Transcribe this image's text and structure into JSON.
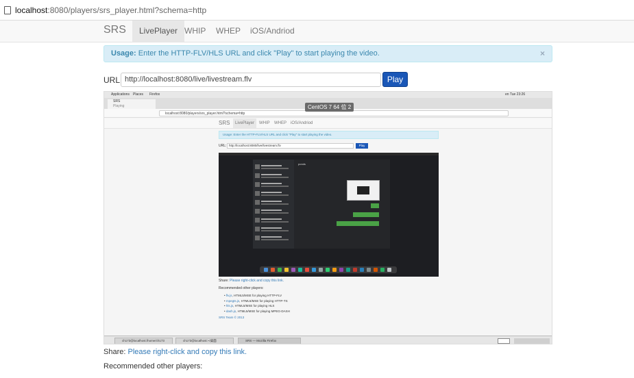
{
  "browser": {
    "url_host": "localhost",
    "url_rest": ":8080/players/srs_player.html?schema=http"
  },
  "navbar": {
    "brand": "SRS",
    "tabs": [
      "LivePlayer",
      "WHIP",
      "WHEP",
      "iOS/Andriod"
    ],
    "active_tab": "LivePlayer"
  },
  "alert": {
    "label": "Usage:",
    "text": "Enter the HTTP-FLV/HLS URL and click \"Play\" to start playing the video.",
    "close": "×"
  },
  "player": {
    "url_label": "URL:",
    "url_value": "http://localhost:8080/live/livestream.flv",
    "play_label": "Play"
  },
  "video": {
    "gnome_menu": [
      "Applications",
      "Places",
      "Firefox"
    ],
    "gnome_status": "en  Tue 23:26",
    "ff_tab": "SRS",
    "ff_tab_sub": "Playing",
    "ff_url": "localhost:8080/players/srs_player.html?schema=http",
    "vm_badge": "CentOS 7 64 位 2",
    "inner_nav": [
      "SRS",
      "LivePlayer",
      "WHIP",
      "WHEP",
      "iOS/Andriod"
    ],
    "inner_alert": "Usage: Enter the HTTP-FLV/HLS URL and click \"Play\" to start playing the video.",
    "inner_url_label": "URL:",
    "inner_url_value": "http://localhost:8080/live/livestream.flv",
    "inner_play": "Play",
    "chat_title": "ponds",
    "inner_share_label": "Share:",
    "inner_share_link": "Please right-click and copy this link.",
    "inner_rec": "Recommended other players:",
    "inner_players": [
      {
        "link": "flv.js",
        "desc": ", HTML5/MSE for playing HTTP-FLV"
      },
      {
        "link": "mpegts.js",
        "desc": ", HTML5/MSE for playing HTTP-TS"
      },
      {
        "link": "hls.js",
        "desc": ", HTML5/MSE for playing HLS"
      },
      {
        "link": "dash.js",
        "desc": ", HTML5/MSE for playing MPEG-DASH"
      }
    ],
    "inner_team": "SRS Team © 2013",
    "taskbar": [
      "ch173@localhost:/home/ch173",
      "ch173@localhost:~/桌面",
      "SRS — Mozilla Firefox"
    ]
  },
  "footer": {
    "share_label": "Share:",
    "share_link": "Please right-click and copy this link.",
    "recommended": "Recommended other players:"
  },
  "colors": {
    "play_button": "#1a57b7",
    "alert_bg": "#d9edf7",
    "link": "#337ab7"
  }
}
